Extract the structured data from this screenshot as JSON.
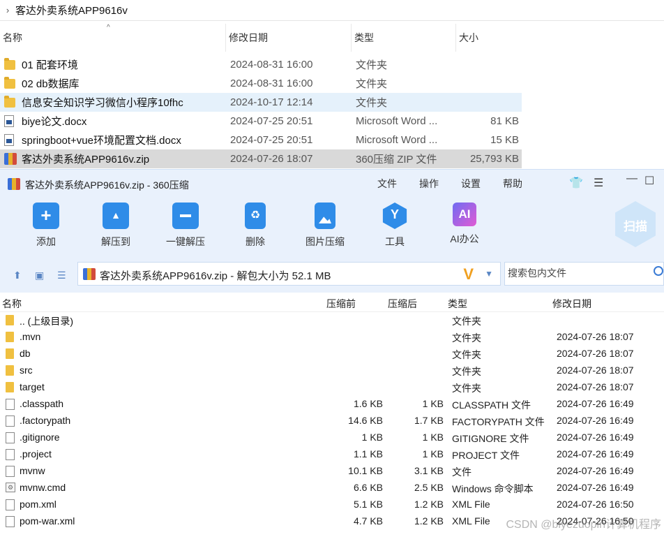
{
  "explorer": {
    "path": "客达外卖系统APP9616v",
    "columns": {
      "name": "名称",
      "date": "修改日期",
      "type": "类型",
      "size": "大小"
    },
    "rows": [
      {
        "name": "01 配套环境",
        "date": "2024-08-31 16:00",
        "type": "文件夹",
        "size": "",
        "icon": "folder-icon"
      },
      {
        "name": "02 db数据库",
        "date": "2024-08-31 16:00",
        "type": "文件夹",
        "size": "",
        "icon": "folder-icon"
      },
      {
        "name": "信息安全知识学习微信小程序10fhc",
        "date": "2024-10-17 12:14",
        "type": "文件夹",
        "size": "",
        "icon": "folder-icon"
      },
      {
        "name": "biye论文.docx",
        "date": "2024-07-25 20:51",
        "type": "Microsoft Word ...",
        "size": "81 KB",
        "icon": "word-doc-icon"
      },
      {
        "name": "springboot+vue环境配置文档.docx",
        "date": "2024-07-25 20:51",
        "type": "Microsoft Word ...",
        "size": "15 KB",
        "icon": "word-doc-icon"
      },
      {
        "name": "客达外卖系统APP9616v.zip",
        "date": "2024-07-26 18:07",
        "type": "360压缩 ZIP 文件",
        "size": "25,793 KB",
        "icon": "zip-icon"
      }
    ]
  },
  "zipwin": {
    "title": "客达外卖系统APP9616v.zip - 360压缩",
    "menu": [
      "文件",
      "操作",
      "设置",
      "帮助"
    ],
    "tools": [
      "添加",
      "解压到",
      "一键解压",
      "删除",
      "图片压缩",
      "工具",
      "AI办公"
    ],
    "scan_label": "扫描",
    "path_text": "客达外卖系统APP9616v.zip - 解包大小为 52.1 MB",
    "search_placeholder": "搜索包内文件",
    "columns": {
      "name": "名称",
      "before": "压缩前",
      "after": "压缩后",
      "type": "类型",
      "date": "修改日期"
    },
    "files": [
      {
        "name": ".. (上级目录)",
        "before": "",
        "after": "",
        "type": "文件夹",
        "date": "",
        "icon": "folder-icon"
      },
      {
        "name": ".mvn",
        "before": "",
        "after": "",
        "type": "文件夹",
        "date": "2024-07-26 18:07",
        "icon": "folder-icon"
      },
      {
        "name": "db",
        "before": "",
        "after": "",
        "type": "文件夹",
        "date": "2024-07-26 18:07",
        "icon": "folder-icon"
      },
      {
        "name": "src",
        "before": "",
        "after": "",
        "type": "文件夹",
        "date": "2024-07-26 18:07",
        "icon": "folder-icon"
      },
      {
        "name": "target",
        "before": "",
        "after": "",
        "type": "文件夹",
        "date": "2024-07-26 18:07",
        "icon": "folder-icon"
      },
      {
        "name": ".classpath",
        "before": "1.6 KB",
        "after": "1 KB",
        "type": "CLASSPATH 文件",
        "date": "2024-07-26 16:49",
        "icon": "file-icon"
      },
      {
        "name": ".factorypath",
        "before": "14.6 KB",
        "after": "1.7 KB",
        "type": "FACTORYPATH 文件",
        "date": "2024-07-26 16:49",
        "icon": "file-icon"
      },
      {
        "name": ".gitignore",
        "before": "1 KB",
        "after": "1 KB",
        "type": "GITIGNORE 文件",
        "date": "2024-07-26 16:49",
        "icon": "file-icon"
      },
      {
        "name": ".project",
        "before": "1.1 KB",
        "after": "1 KB",
        "type": "PROJECT 文件",
        "date": "2024-07-26 16:49",
        "icon": "file-icon"
      },
      {
        "name": "mvnw",
        "before": "10.1 KB",
        "after": "3.1 KB",
        "type": "文件",
        "date": "2024-07-26 16:49",
        "icon": "file-icon"
      },
      {
        "name": "mvnw.cmd",
        "before": "6.6 KB",
        "after": "2.5 KB",
        "type": "Windows 命令脚本",
        "date": "2024-07-26 16:49",
        "icon": "cmd-script-icon"
      },
      {
        "name": "pom.xml",
        "before": "5.1 KB",
        "after": "1.2 KB",
        "type": "XML File",
        "date": "2024-07-26 16:50",
        "icon": "file-icon"
      },
      {
        "name": "pom-war.xml",
        "before": "4.7 KB",
        "after": "1.2 KB",
        "type": "XML File",
        "date": "2024-07-26 16:50",
        "icon": "file-icon"
      }
    ]
  },
  "watermark": "CSDN @biyezuopin计算机程序"
}
